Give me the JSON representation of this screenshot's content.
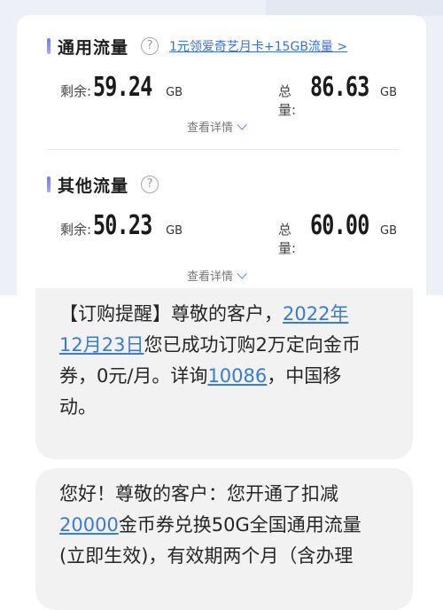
{
  "general": {
    "title": "通用流量",
    "promo": "1元领爱奇艺月卡+15GB流量 >",
    "remaining_label": "剩余:",
    "remaining_value": "59.24",
    "remaining_unit": "GB",
    "total_label": "总量:",
    "total_value": "86.63",
    "total_unit": "GB",
    "detail": "查看详情"
  },
  "other": {
    "title": "其他流量",
    "remaining_label": "剩余:",
    "remaining_value": "50.23",
    "remaining_unit": "GB",
    "total_label": "总量:",
    "total_value": "60.00",
    "total_unit": "GB",
    "detail": "查看详情"
  },
  "icons": {
    "help": "help-icon",
    "expand": "chevron-down-icon"
  },
  "colors": {
    "accent": "#6f7cf6",
    "link": "#3a7bd5",
    "bubble": "#f2f2f2"
  },
  "message1": {
    "l1_text": "【订购提醒】尊敬的客户，",
    "l1_link": "2022年",
    "l2_link": "12月23日",
    "l2_text": "您已成功订购2万定向金币",
    "l3_text_a": "券，0元/月。详询",
    "l3_link": "10086",
    "l3_text_b": "，中国移",
    "l4_text": "动。"
  },
  "message2": {
    "l1_text": "您好！尊敬的客户：您开通了扣减",
    "l2_link": "20000",
    "l2_text": "金币券兑换50G全国通用流量",
    "l3_text": "(立即生效)，有效期两个月（含办理"
  }
}
